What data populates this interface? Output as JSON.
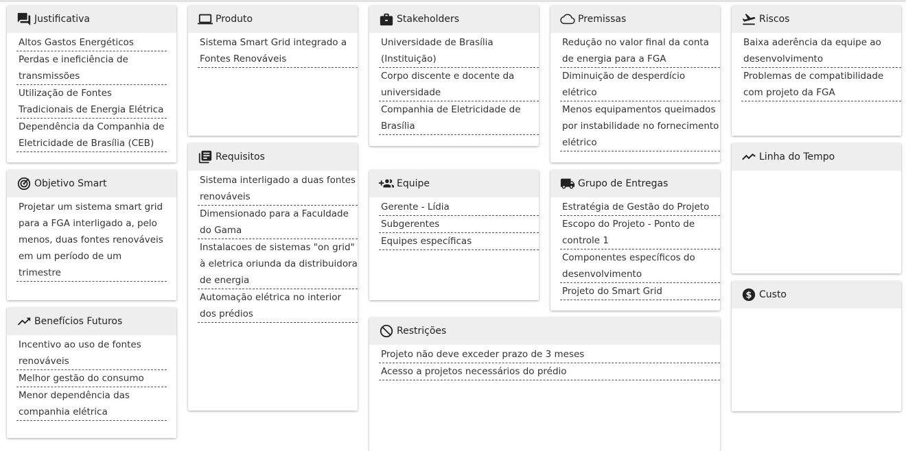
{
  "cards": {
    "justificativa": {
      "title": "Justificativa",
      "items": [
        "Altos Gastos Energéticos",
        "Perdas e ineficiência de transmissões",
        "Utilização de Fontes Tradicionais de Energia Elétrica",
        "Dependência da Companhia de Eletricidade de Brasília (CEB)"
      ]
    },
    "objetivo": {
      "title": "Objetivo Smart",
      "items": [
        "Projetar um sistema smart grid para a FGA interligado a, pelo menos, duas fontes renováveis em um período de um trimestre"
      ]
    },
    "beneficios": {
      "title": "Benefícios Futuros",
      "items": [
        "Incentivo ao uso de fontes renováveis",
        "Melhor gestão do consumo",
        "Menor dependência das companhia elétrica"
      ]
    },
    "produto": {
      "title": "Produto",
      "items": [
        "Sistema Smart Grid integrado a Fontes Renováveis"
      ]
    },
    "requisitos": {
      "title": "Requisitos",
      "items": [
        "Sistema interligado a duas fontes renováveis",
        "Dimensionado para a Faculdade do Gama",
        "Instalacoes de sistemas \"on grid\" à eletrica oriunda da distribuidora de energia",
        "Automação elétrica no interior dos prédios"
      ]
    },
    "stakeholders": {
      "title": "Stakeholders",
      "items": [
        "Universidade de Brasília (Instituição)",
        "Corpo discente e docente da universidade",
        "Companhia de Eletricidade de Brasília"
      ]
    },
    "equipe": {
      "title": "Equipe",
      "items": [
        "Gerente - Lídia",
        "Subgerentes",
        "Equipes específicas"
      ]
    },
    "premissas": {
      "title": "Premissas",
      "items": [
        "Redução no valor final da conta de energia para a FGA",
        "Diminuição de desperdício elétrico",
        "Menos equipamentos queimados por instabilidade no fornecimento elétrico"
      ]
    },
    "entregas": {
      "title": "Grupo de Entregas",
      "items": [
        "Estratégia de Gestão do Projeto",
        "Escopo do Projeto - Ponto de controle 1",
        "Componentes específicos do desenvolvimento",
        "Projeto do Smart Grid"
      ]
    },
    "restricoes": {
      "title": "Restrições",
      "items": [
        "Projeto não deve exceder prazo de 3 meses",
        "Acesso a projetos necessários do prédio"
      ]
    },
    "riscos": {
      "title": "Riscos",
      "items": [
        "Baixa aderência da equipe ao desenvolvimento",
        "Problemas de compatibilidade com projeto da FGA"
      ]
    },
    "linha": {
      "title": "Linha do Tempo",
      "items": []
    },
    "custo": {
      "title": "Custo",
      "items": []
    }
  },
  "icons": {
    "justificativa": "forum-icon",
    "objetivo": "target-icon",
    "beneficios": "trending-up-icon",
    "produto": "laptop-icon",
    "requisitos": "library-books-icon",
    "stakeholders": "briefcase-icon",
    "equipe": "group-add-icon",
    "premissas": "cloud-icon",
    "entregas": "truck-icon",
    "restricoes": "block-icon",
    "riscos": "flight-takeoff-icon",
    "linha": "timeline-icon",
    "custo": "dollar-icon"
  }
}
